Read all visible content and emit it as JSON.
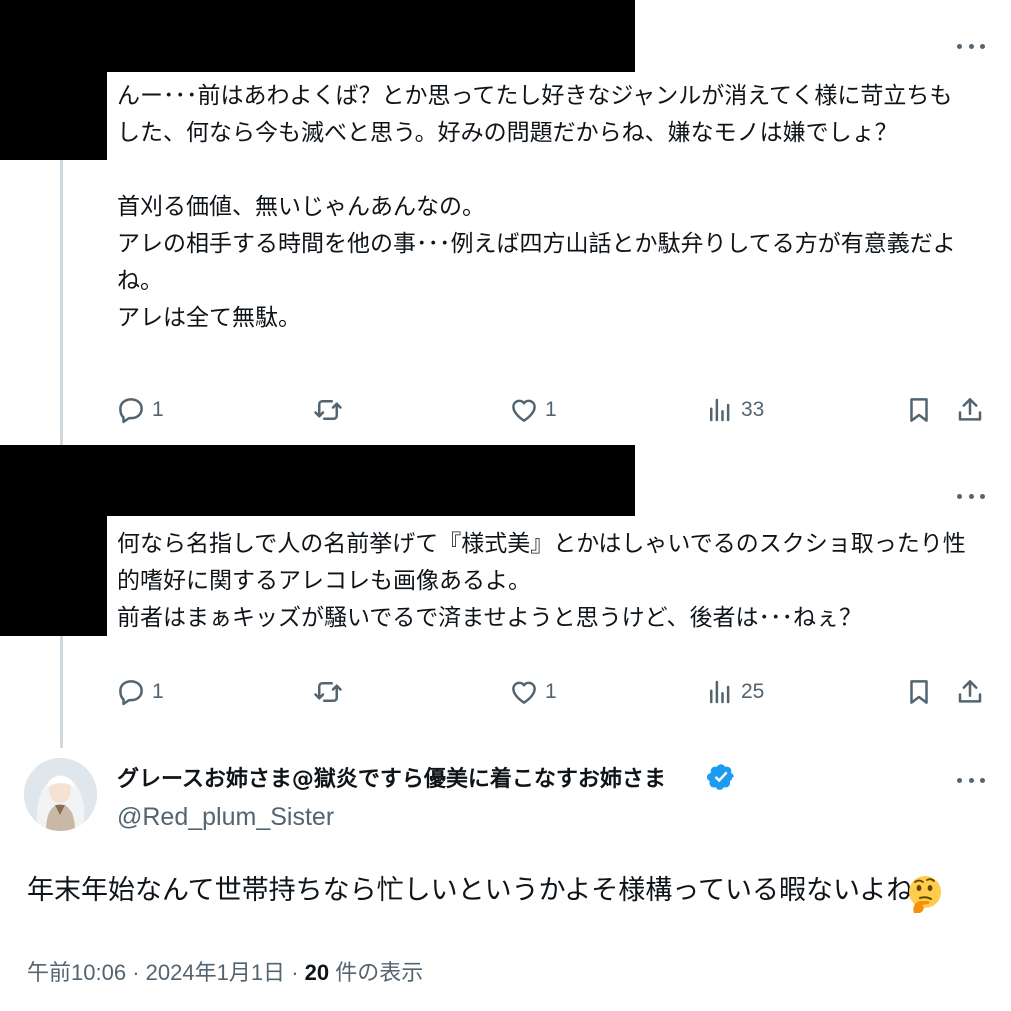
{
  "reply1": {
    "lines": [
      "んー･･･前はあわよくば？とか思ってたし好きなジャンルが消えてく様に苛立ちも",
      "した、何なら今も滅べと思う。好みの問題だからね、嫌なモノは嫌でしょ？",
      "",
      "首刈る価値、無いじゃんあんなの。",
      "アレの相手する時間を他の事･･･例えば四方山話とか駄弁りしてる方が有意義だよ",
      "ね。",
      "アレは全て無駄。"
    ],
    "actions": {
      "replies": "1",
      "reposts": "",
      "likes": "1",
      "views": "33"
    }
  },
  "reply2": {
    "lines": [
      "何なら名指しで人の名前挙げて『様式美』とかはしゃいでるのスクショ取ったり性",
      "的嗜好に関するアレコレも画像あるよ。",
      "前者はまぁキッズが騒いでるで済ませようと思うけど、後者は･･･ねぇ？"
    ],
    "actions": {
      "replies": "1",
      "reposts": "",
      "likes": "1",
      "views": "25"
    }
  },
  "main_tweet": {
    "display_name": "グレースお姉さま@獄炎ですら優美に着こなすお姉さま",
    "handle": "@Red_plum_Sister",
    "verified": true,
    "text": "年末年始なんて世帯持ちなら忙しいというかよそ様構っている暇ないよね",
    "emoji": "thinking-face",
    "time": "午前10:06",
    "date": "2024年1月1日",
    "views_count": "20",
    "views_label": "件の表示",
    "separator": "·"
  },
  "colors": {
    "text": "#0f1419",
    "muted": "#536471",
    "thread_line": "#cfd9de",
    "verified": "#1d9bf0",
    "redaction": "#000000"
  }
}
